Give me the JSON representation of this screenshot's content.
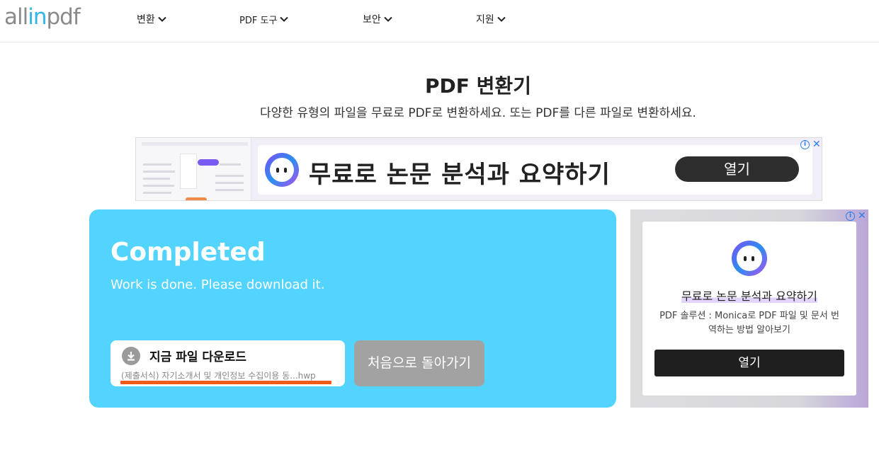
{
  "brand": {
    "logo_part1": "all",
    "logo_part2": "in",
    "logo_part3": "pdf",
    "accent": "#2fb6e8"
  },
  "nav": {
    "items": [
      {
        "label": "변환"
      },
      {
        "label": "PDF 도구"
      },
      {
        "label": "보안"
      },
      {
        "label": "지원"
      }
    ]
  },
  "page": {
    "title": "PDF 변환기",
    "subtitle": "다양한 유형의 파일을 무료로 PDF로 변환하세요. 또는 PDF를 다른 파일로 변환하세요."
  },
  "ad_top": {
    "headline": "무료로 논문 분석과 요약하기",
    "button": "열기"
  },
  "result": {
    "title": "Completed",
    "message": "Work is done. Please download it.",
    "download_label": "지금 파일 다운로드",
    "file_name": "(제출서식) 자기소개서 및 개인정보 수집이용 동...hwp",
    "back_label": "처음으로 돌아가기",
    "card_color": "#52d4fe"
  },
  "ad_right": {
    "headline": "무료로 논문 분석과 요약하기",
    "description": "PDF 솔루션 : Monica로 PDF 파일 및 문서 번역하는 방법 알아보기",
    "button": "열기"
  }
}
